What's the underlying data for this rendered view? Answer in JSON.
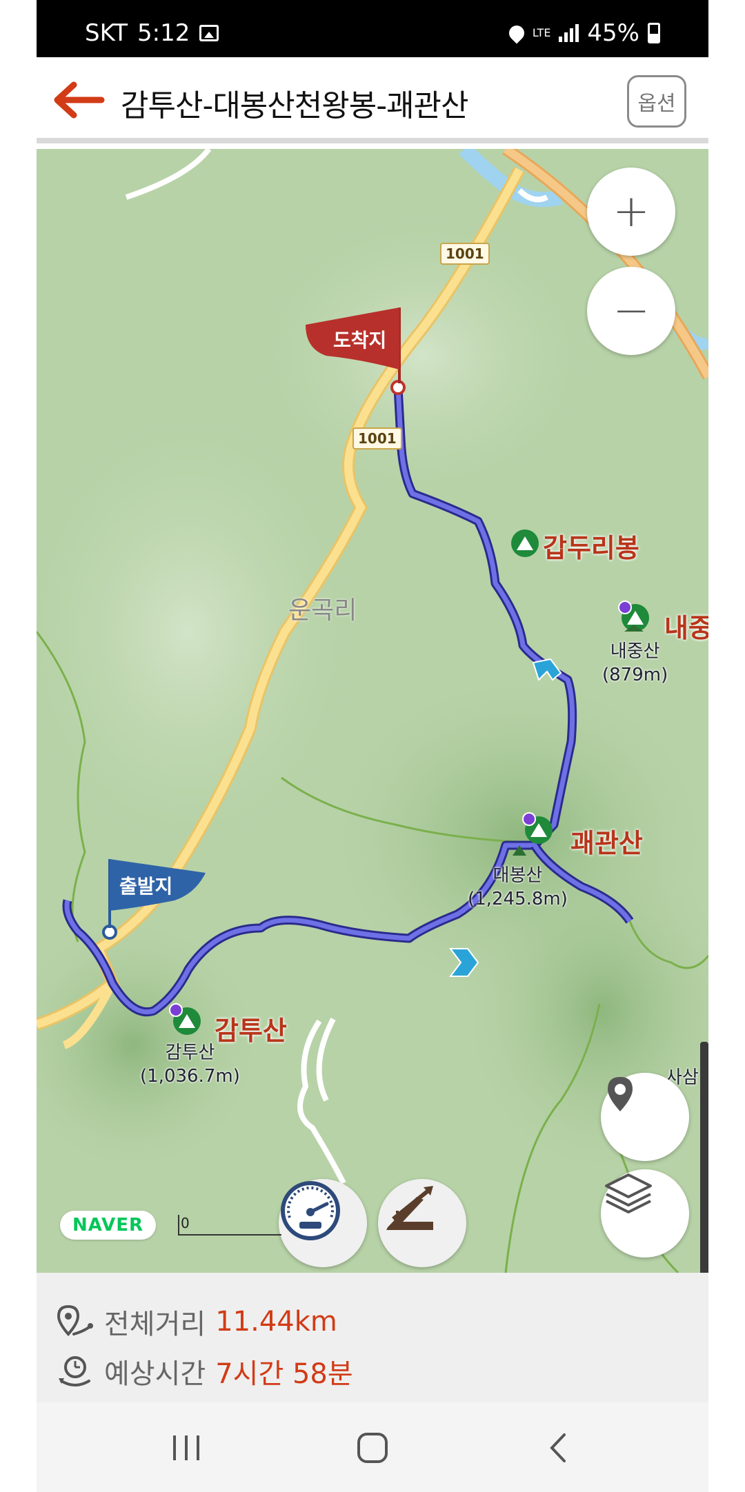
{
  "status_bar": {
    "carrier": "SKT",
    "time": "5:12",
    "network": "LTE",
    "battery": "45%"
  },
  "header": {
    "title": "감투산-대봉산천왕봉-괘관산",
    "option_label": "옵션"
  },
  "map": {
    "flags": {
      "end": "도착지",
      "start": "출발지"
    },
    "road_numbers": [
      "1001",
      "1001"
    ],
    "village": "운곡리",
    "peaks": [
      {
        "big": "갑두리봉"
      },
      {
        "big": "내중",
        "name": "내중산",
        "elevation": "(879m)"
      },
      {
        "big": "괘관산"
      },
      {
        "name": "대봉산",
        "elevation": "(1,245.8m)"
      },
      {
        "big": "감투산",
        "name": "감투산",
        "elevation": "(1,036.7m)"
      }
    ],
    "partial_label": "사삼",
    "naver_logo": "NAVER",
    "scale_zero": "0",
    "zoom_in": "+",
    "zoom_out": "−"
  },
  "info": {
    "distance_label": "전체거리",
    "distance_value": "11.44km",
    "time_label": "예상시간",
    "time_value": "7시간 58분"
  },
  "colors": {
    "accent": "#d13b16",
    "route": "#4a4bc7",
    "map_bg": "#b7d2a7"
  }
}
